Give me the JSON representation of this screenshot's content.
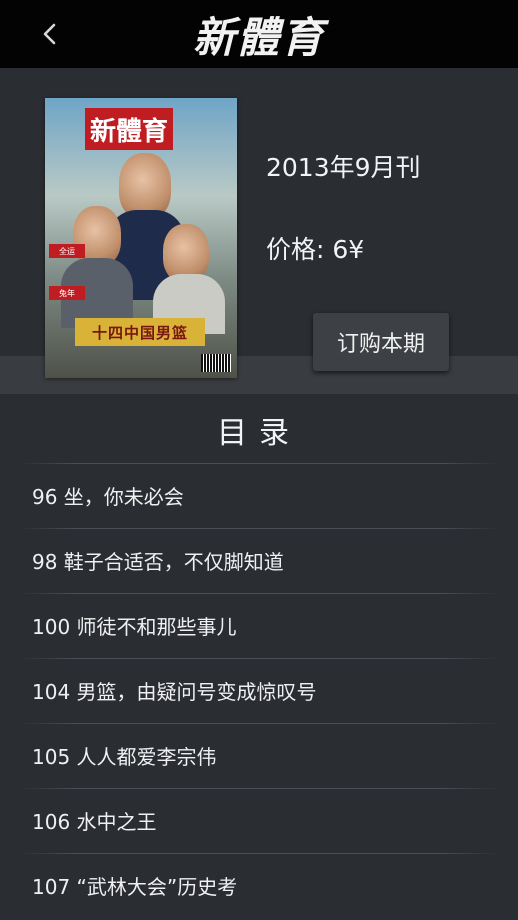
{
  "navbar": {
    "logo_text": "新體育",
    "back_icon": "chevron-left-icon"
  },
  "issue": {
    "title": "2013年9月刊",
    "price": "价格: 6¥",
    "order_button": "订购本期",
    "cover": {
      "masthead": "新體育",
      "headline": "十四中国男篮",
      "side_labels": [
        "全运",
        "兔年"
      ]
    }
  },
  "toc": {
    "heading": "目录",
    "items": [
      "96 坐，你未必会",
      "98 鞋子合适否，不仅脚知道",
      "100 师徒不和那些事儿",
      "104 男篮，由疑问号变成惊叹号",
      "105 人人都爱李宗伟",
      "106 水中之王",
      "107 “武林大会”历史考"
    ]
  },
  "colors": {
    "navbar_bg": "#030303",
    "page_bg": "#2a2d31",
    "band_bg": "#393c40",
    "button_bg": "#3d4044",
    "cover_masthead": "#c01d22"
  }
}
